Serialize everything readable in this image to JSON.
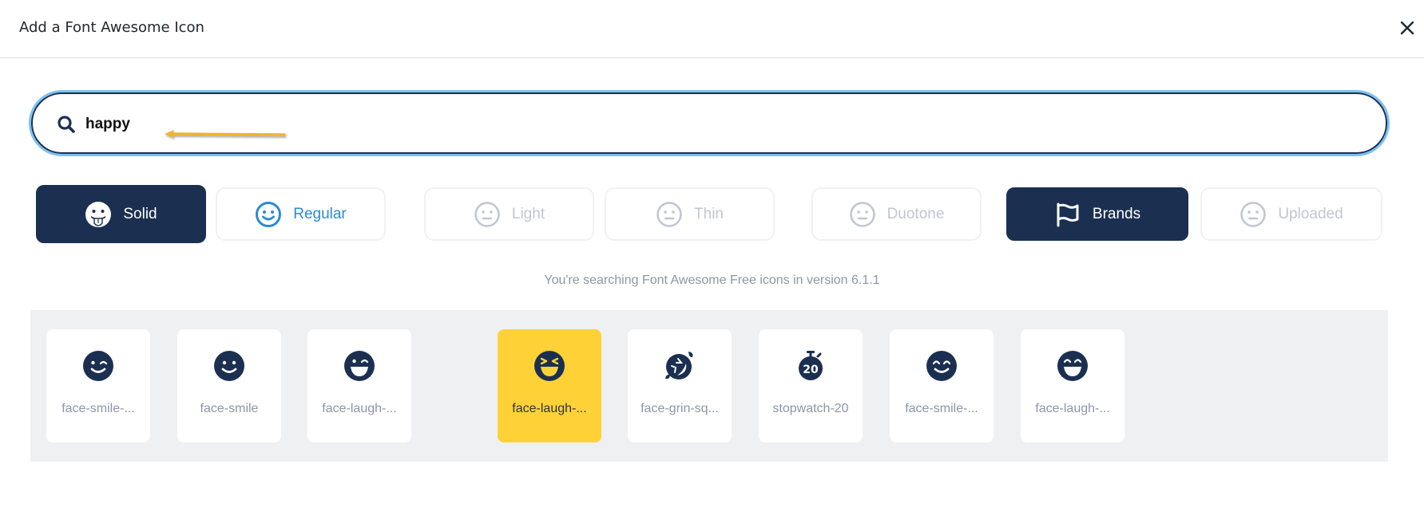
{
  "dialog": {
    "title": "Add a Font Awesome Icon",
    "close_icon": "close-icon"
  },
  "search": {
    "value": "happy",
    "icon": "search-icon",
    "annotation": "arrow-pointing-to-search-text"
  },
  "styles": [
    {
      "label": "Solid",
      "icon": "face-grin-tongue-icon",
      "state": "active"
    },
    {
      "label": "Regular",
      "icon": "face-smile-icon",
      "state": "enabled"
    },
    {
      "label": "Light",
      "icon": "face-meh-icon",
      "state": "disabled"
    },
    {
      "label": "Thin",
      "icon": "face-meh-icon",
      "state": "disabled"
    },
    {
      "label": "Duotone",
      "icon": "face-meh-icon",
      "state": "disabled"
    },
    {
      "label": "Brands",
      "icon": "flag-icon",
      "state": "active"
    },
    {
      "label": "Uploaded",
      "icon": "face-meh-icon",
      "state": "disabled"
    }
  ],
  "hint": "You're searching Font Awesome Free icons in version 6.1.1",
  "results": [
    {
      "label": "face-smile-...",
      "icon": "face-smile-wink-icon",
      "selected": false
    },
    {
      "label": "face-smile",
      "icon": "face-smile-icon",
      "selected": false
    },
    {
      "label": "face-laugh-...",
      "icon": "face-laugh-wink-icon",
      "selected": false
    },
    {
      "label": "face-laugh-...",
      "icon": "face-laugh-squint-icon",
      "selected": true
    },
    {
      "label": "face-grin-sq...",
      "icon": "face-grin-squint-tears-icon",
      "selected": false
    },
    {
      "label": "stopwatch-20",
      "icon": "stopwatch-20-icon",
      "selected": false
    },
    {
      "label": "face-smile-...",
      "icon": "face-smile-beam-icon",
      "selected": false
    },
    {
      "label": "face-laugh-...",
      "icon": "face-laugh-beam-icon",
      "selected": false
    }
  ],
  "colors": {
    "navy": "#1b3051",
    "accent_blue": "#2a8ad6",
    "focus_ring": "#7cc1f4",
    "selected_yellow": "#fed236",
    "disabled_text": "#c2c6d3",
    "panel_bg": "#eff0f2",
    "annotation_arrow": "#f0b429"
  }
}
